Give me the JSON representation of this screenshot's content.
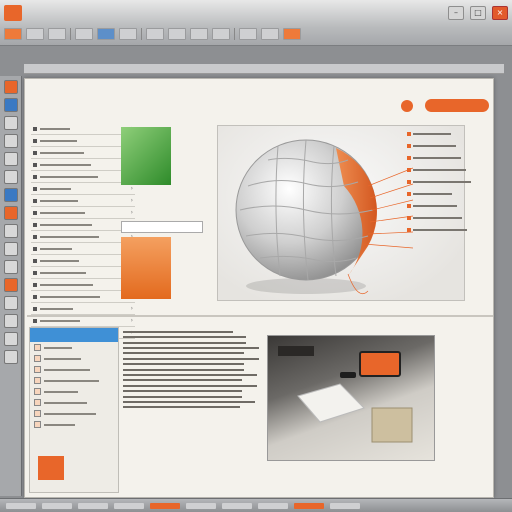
{
  "app": {
    "icon_label": "",
    "menu": [],
    "window_controls": [
      "–",
      "□",
      "×"
    ]
  },
  "document": {
    "header_left": "",
    "header_mid": "",
    "header_right": "",
    "pill_label": "",
    "pill_end": ""
  },
  "left_list": [],
  "swatches": {
    "green_label": "",
    "field_value": "",
    "orange_label": ""
  },
  "viewport": {
    "caption": "",
    "callouts": [
      "",
      "",
      "",
      "",
      "",
      "",
      "",
      "",
      ""
    ]
  },
  "side_panel": {
    "title": "",
    "items": [],
    "badge": ""
  },
  "text_column": {
    "heading": "",
    "paragraphs": []
  },
  "photo": {
    "caption": ""
  },
  "colors": {
    "accent": "#e8662a",
    "blue": "#3f90d6",
    "green": "#2e8b2a"
  },
  "icons": [
    "app-icon",
    "minimize-icon",
    "maximize-icon",
    "close-icon",
    "chevron-right-icon",
    "bullet-icon"
  ]
}
